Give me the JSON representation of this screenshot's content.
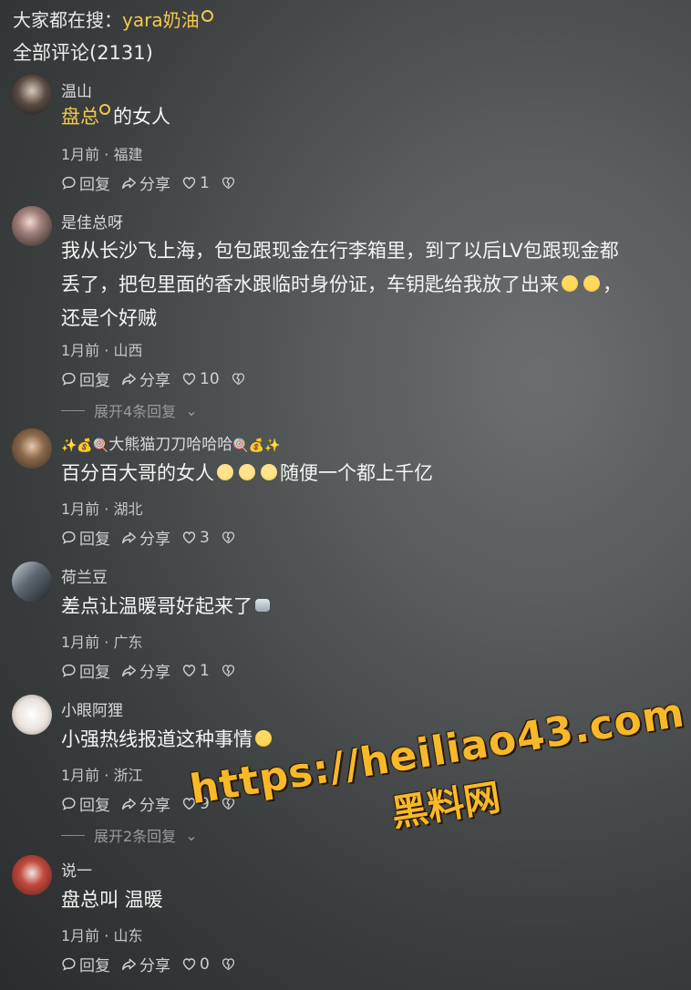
{
  "header": {
    "search_prefix": "大家都在搜：",
    "search_keyword": "yara奶油",
    "total_label": "全部评论(2131)"
  },
  "actions": {
    "reply": "回复",
    "share": "分享"
  },
  "comments": [
    {
      "name": "温山",
      "body_link": "盘总",
      "body_rest": "的女人",
      "meta": "1月前 · 福建",
      "likes": "1"
    },
    {
      "name": "是佳总呀",
      "body_line1": "我从长沙飞上海，包包跟现金在行李箱里，到了以后LV包跟现金都",
      "body_line2": "丢了，把包里面的香水跟临时身份证，车钥匙给我放了出来",
      "body_line2_tail": "，",
      "body_line3": "还是个好贼",
      "meta": "1月前 · 山西",
      "likes": "10",
      "expand": "展开4条回复"
    },
    {
      "name_prefix": "✨💰🍭",
      "name": "大熊猫刀刀哈哈哈",
      "name_suffix": "🍭💰✨",
      "body_a": "百分百大哥的女人",
      "body_b": "随便一个都上千亿",
      "meta": "1月前 · 湖北",
      "likes": "3"
    },
    {
      "name": "荷兰豆",
      "body": "差点让温暖哥好起来了",
      "meta": "1月前 · 广东",
      "likes": "1"
    },
    {
      "name": "小眼阿狸",
      "body": "小强热线报道这种事情",
      "meta": "1月前 · 浙江",
      "likes": "9",
      "expand": "展开2条回复"
    },
    {
      "name": "说一",
      "body": "盘总叫 温暖",
      "meta": "1月前 · 山东",
      "likes": "0"
    }
  ],
  "watermark": {
    "url": "https://heiliao43.com",
    "sub": "黑料网"
  },
  "colors": {
    "keyword": "#f2c94c",
    "watermark": "#f7b92a"
  }
}
